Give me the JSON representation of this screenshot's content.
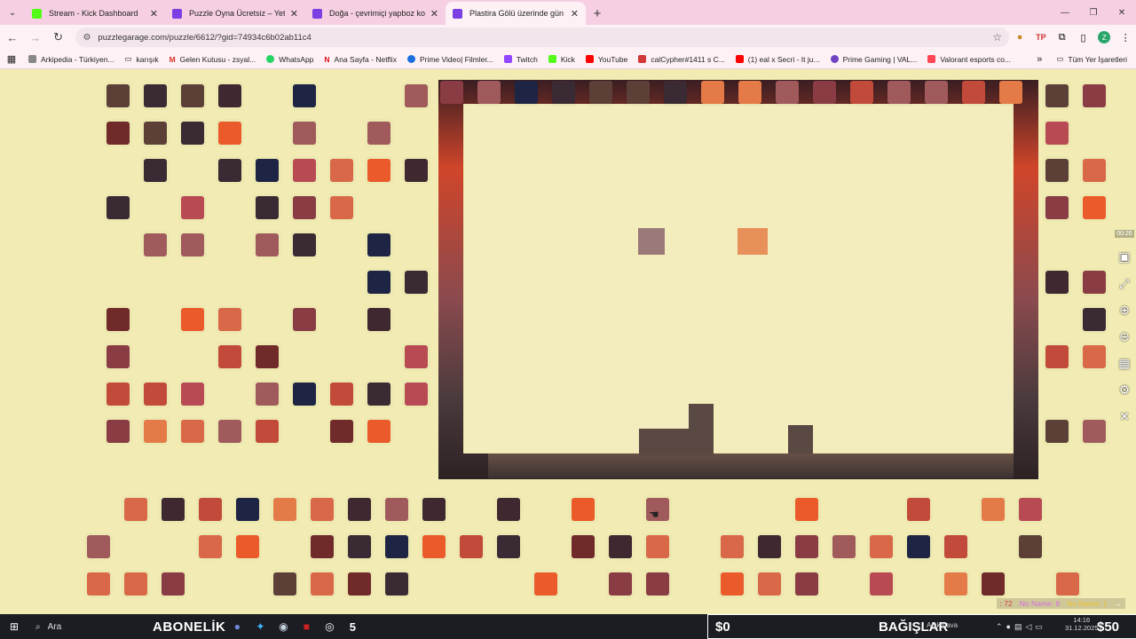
{
  "browser": {
    "tabs": [
      {
        "title": "Stream - Kick Dashboard",
        "favicon_color": "#53fc18",
        "active": false
      },
      {
        "title": "Puzzle Oyna Ücretsiz – Yetişkinl",
        "favicon_color": "#7b3fe4",
        "active": false
      },
      {
        "title": "Doğa - çevrimiçi yapboz kolekc",
        "favicon_color": "#7b3fe4",
        "active": false
      },
      {
        "title": "Plastira Gölü üzerinde gün b",
        "favicon_color": "#7b3fe4",
        "active": true
      }
    ],
    "url": "puzzlegarage.com/puzzle/6612/?gid=74934c6b02ab11c4",
    "bookmarks": [
      {
        "label": "Arkipedia - Türkiyen...",
        "color": "#888888"
      },
      {
        "label": "karışık",
        "color": "#555555"
      },
      {
        "label": "Gelen Kutusu - zsyal...",
        "color": "#d93025"
      },
      {
        "label": "WhatsApp",
        "color": "#25d366"
      },
      {
        "label": "Ana Sayfa - Netflix",
        "color": "#e50914"
      },
      {
        "label": "Prime Video| Filmler...",
        "color": "#1a6ee0"
      },
      {
        "label": "Twitch",
        "color": "#9146ff"
      },
      {
        "label": "Kick",
        "color": "#53fc18"
      },
      {
        "label": "YouTube",
        "color": "#ff0000"
      },
      {
        "label": "calCypher#1411 s C...",
        "color": "#d13838"
      },
      {
        "label": "(1) eal x Secri - It ju...",
        "color": "#ff0000"
      },
      {
        "label": "Prime Gaming | VAL...",
        "color": "#6f42c1"
      },
      {
        "label": "Valorant esports co...",
        "color": "#ff4655"
      }
    ],
    "all_bookmarks": "Tüm Yer İşaretleri"
  },
  "puzzle": {
    "timer": "00:26",
    "stats": {
      "s1": ": 72",
      "s2": "No Name: 8",
      "s3": "No Name: 1"
    }
  },
  "taskbar": {
    "search": "Ara",
    "abonelik": "ABONELİK",
    "count": "5",
    "money_left": "$0",
    "bagislar": "BAĞIŞLAR",
    "weather": "Açık hava",
    "time": "14:16",
    "date": "31.12.2025",
    "money_right": "$50"
  }
}
